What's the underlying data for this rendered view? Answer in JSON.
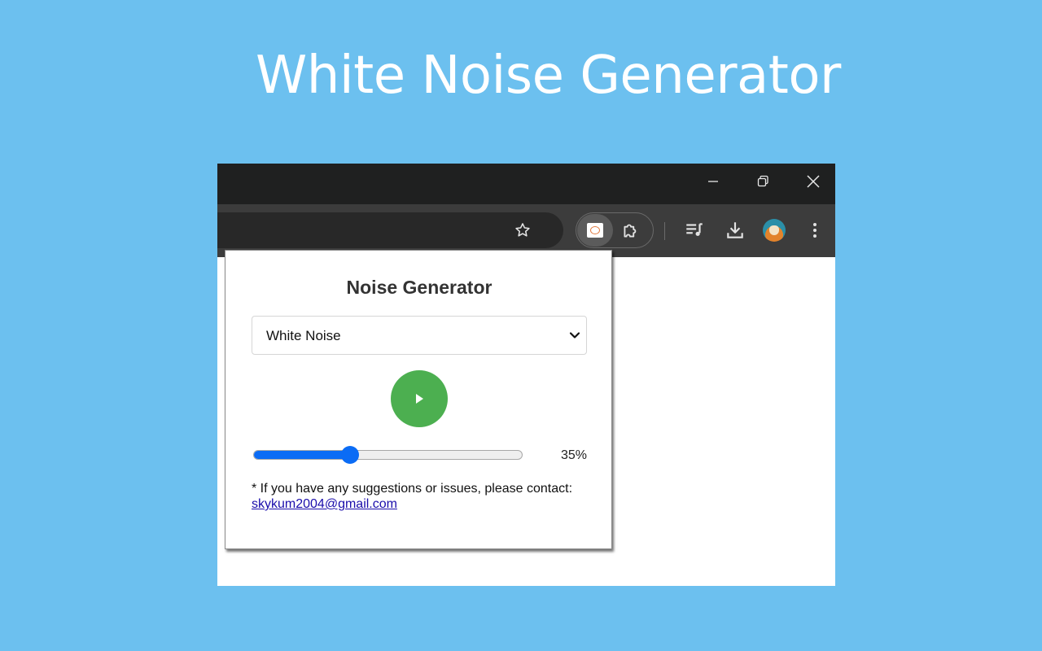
{
  "banner": {
    "title": "White Noise Generator"
  },
  "browser": {
    "window_controls": [
      "minimize",
      "restore",
      "close"
    ],
    "toolbar_icons": [
      "star-icon",
      "extension-icon",
      "puzzle-icon",
      "media-controls-icon",
      "download-icon",
      "profile-avatar",
      "more-menu-icon"
    ]
  },
  "popup": {
    "title": "Noise Generator",
    "noise_type": {
      "selected": "White Noise"
    },
    "play_button": {
      "state": "paused",
      "icon": "play-icon"
    },
    "volume": {
      "value": 35,
      "label": "35%"
    },
    "contact_note": "* If you have any suggestions or issues, please contact:",
    "contact_email": "skykum2004@gmail.com"
  },
  "colors": {
    "page_background": "#6cc0ef",
    "play_button": "#4caf50",
    "slider_accent": "#0b6cf5",
    "link": "#1a0dab"
  }
}
